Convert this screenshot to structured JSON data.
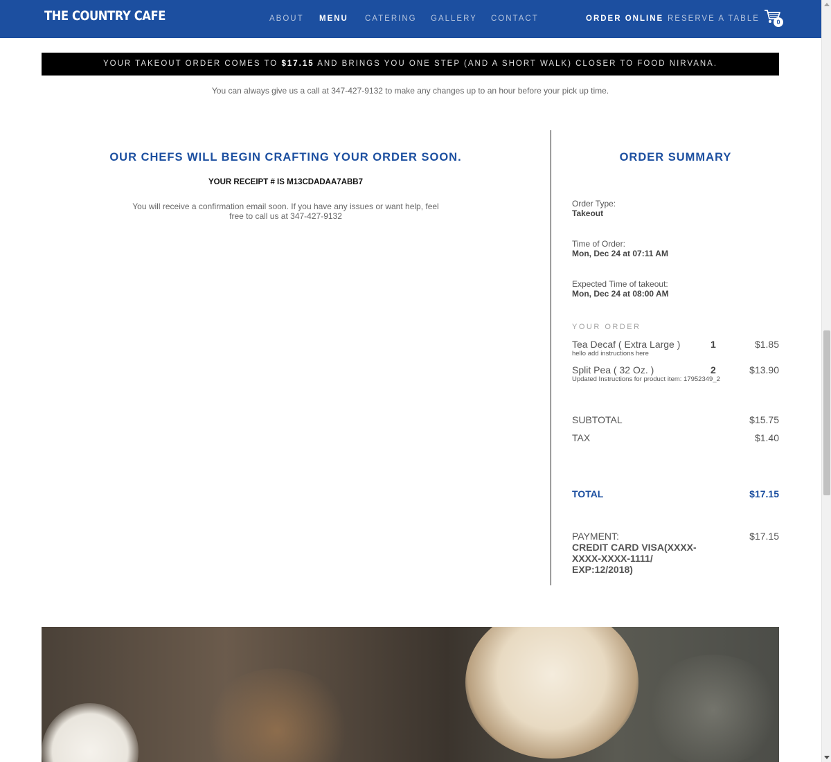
{
  "brand": {
    "logo_text": "THE COUNTRY CAFE"
  },
  "nav": {
    "items": [
      {
        "label": "ABOUT"
      },
      {
        "label": "MENU"
      },
      {
        "label": "CATERING"
      },
      {
        "label": "GALLERY"
      },
      {
        "label": "CONTACT"
      }
    ],
    "order_online": "ORDER ONLINE",
    "reserve": "RESERVE A TABLE",
    "cart_count": "0",
    "accent_color": "#1c4fa0"
  },
  "banner": {
    "prefix": "YOUR TAKEOUT ORDER COMES TO ",
    "amount": "$17.15",
    "suffix": " AND BRINGS YOU ONE STEP (AND A SHORT WALK) CLOSER TO FOOD NIRVANA."
  },
  "call_note": "You can always give us a call at 347-427-9132 to make any changes up to an hour before your pick up time.",
  "confirmation": {
    "heading": "OUR CHEFS WILL BEGIN CRAFTING YOUR ORDER SOON.",
    "receipt": "YOUR RECEIPT # IS M13CDADAA7ABB7",
    "message": "You will receive a confirmation email soon. If you have any issues or want help, feel free to call us at 347-427-9132"
  },
  "summary": {
    "title": "ORDER SUMMARY",
    "order_type_label": "Order Type:",
    "order_type": "Takeout",
    "time_label": "Time of Order:",
    "time_value": "Mon, Dec 24 at 07:11 AM",
    "expected_label": "Expected Time of takeout:",
    "expected_value": "Mon, Dec 24 at 08:00 AM",
    "your_order_label": "YOUR ORDER",
    "items": [
      {
        "name": "Tea Decaf ( Extra Large )",
        "note": "hello add instructions here",
        "qty": "1",
        "price": "$1.85"
      },
      {
        "name": "Split Pea ( 32 Oz. )",
        "note": "Updated Instructions for product item: 17952349_2",
        "qty": "2",
        "price": "$13.90"
      }
    ],
    "subtotal_label": "SUBTOTAL",
    "subtotal": "$15.75",
    "tax_label": "TAX",
    "tax": "$1.40",
    "total_label": "TOTAL",
    "total": "$17.15",
    "payment_label": "PAYMENT:",
    "payment_method": "CREDIT CARD VISA(XXXX-XXXX-XXXX-1111/ EXP:12/2018)",
    "payment_amount": "$17.15"
  }
}
